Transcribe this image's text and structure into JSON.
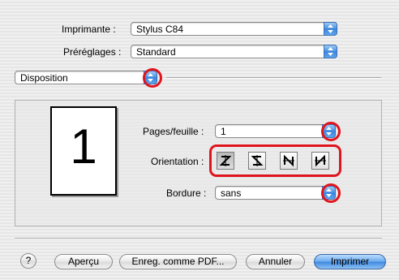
{
  "printer": {
    "label": "Imprimante :",
    "value": "Stylus C84"
  },
  "presets": {
    "label": "Préréglages :",
    "value": "Standard"
  },
  "panel": {
    "value": "Disposition"
  },
  "preview": {
    "page_number": "1"
  },
  "layout": {
    "pages_label": "Pages/feuille :",
    "pages_value": "1",
    "orientation_label": "Orientation :",
    "orientation_icons": [
      "z-orientation-icon",
      "reverse-z-orientation-icon",
      "n-orientation-icon",
      "reverse-n-orientation-icon"
    ],
    "border_label": "Bordure :",
    "border_value": "sans"
  },
  "buttons": {
    "help": "?",
    "preview": "Aperçu",
    "save_pdf": "Enreg. comme PDF...",
    "cancel": "Annuler",
    "print": "Imprimer"
  },
  "colors": {
    "highlight": "#e0141c",
    "accent": "#3a86dd"
  }
}
